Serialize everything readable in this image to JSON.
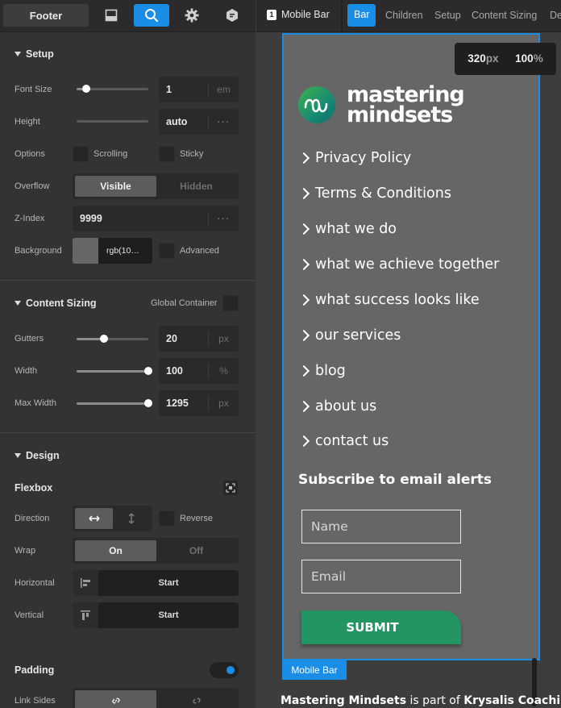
{
  "left_panel": {
    "tabs": {
      "footer_label": "Footer"
    },
    "setup": {
      "title": "Setup",
      "font_size": {
        "label": "Font Size",
        "value": "1",
        "unit": "em",
        "slider_level": 0.14
      },
      "height": {
        "label": "Height",
        "value": "auto",
        "more": "···"
      },
      "options": {
        "label": "Options",
        "scrolling": "Scrolling",
        "sticky": "Sticky"
      },
      "overflow": {
        "label": "Overflow",
        "visible": "Visible",
        "hidden": "Hidden",
        "selected": "Visible"
      },
      "z_index": {
        "label": "Z-Index",
        "value": "9999",
        "more": "···"
      },
      "background": {
        "label": "Background",
        "value": "rgb(10…",
        "swatch": "#666666",
        "advanced": "Advanced"
      }
    },
    "content_sizing": {
      "title": "Content Sizing",
      "global_container": "Global Container",
      "gutters": {
        "label": "Gutters",
        "value": "20",
        "unit": "px",
        "slider_level": 0.38
      },
      "width": {
        "label": "Width",
        "value": "100",
        "unit": "%",
        "slider_level": 1.0
      },
      "max_width": {
        "label": "Max Width",
        "value": "1295",
        "unit": "px",
        "slider_level": 1.0
      }
    },
    "design": {
      "title": "Design",
      "flexbox": "Flexbox",
      "direction": {
        "label": "Direction",
        "reverse": "Reverse"
      },
      "wrap": {
        "label": "Wrap",
        "on": "On",
        "off": "Off",
        "selected": "On"
      },
      "horizontal": {
        "label": "Horizontal",
        "value": "Start"
      },
      "vertical": {
        "label": "Vertical",
        "value": "Start"
      },
      "padding": {
        "label": "Padding",
        "toggle_on": true
      },
      "link_sides": {
        "label": "Link Sides"
      }
    }
  },
  "right_panel": {
    "breadcrumb": {
      "number": "1",
      "label": "Mobile Bar"
    },
    "tabs": [
      "Bar",
      "Children",
      "Setup",
      "Content Sizing",
      "De"
    ],
    "active_tab": "Bar",
    "zoom": {
      "width": "320",
      "width_unit": "px",
      "zoom": "100",
      "zoom_unit": "%"
    },
    "preview": {
      "logo_line1": "mastering",
      "logo_line2": "mindsets",
      "links": [
        "Privacy Policy",
        "Terms & Conditions",
        "what we do",
        "what we achieve together",
        "what success looks like",
        "our services",
        "blog",
        "about us",
        "contact us"
      ],
      "subscribe_title": "Subscribe to email alerts",
      "name_placeholder": "Name",
      "email_placeholder": "Email",
      "submit_label": "SUBMIT",
      "element_tag": "Mobile Bar",
      "footer_bold1": "Mastering Mindsets",
      "footer_mid": " is part of ",
      "footer_bold2": "Krysalis Coaching Ltd"
    }
  },
  "colors": {
    "accent": "#1a8ee6",
    "submit_green": "#239563",
    "bar_background": "#666666"
  }
}
